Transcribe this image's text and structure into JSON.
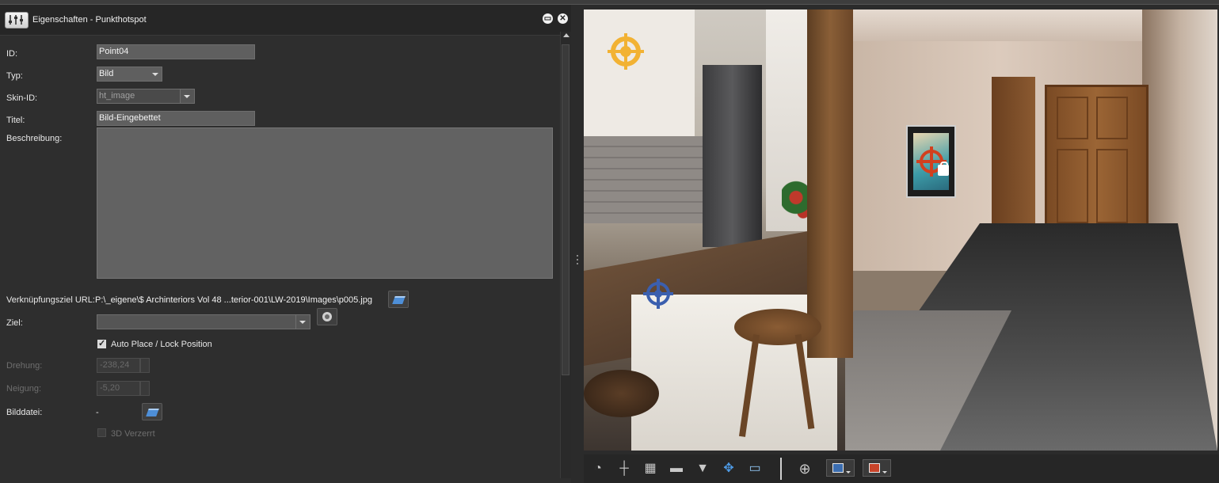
{
  "window": {
    "title": "Eigenschaften - Punkthotspot",
    "restore_icon": "restore-icon",
    "close_icon": "close-icon"
  },
  "form": {
    "id": {
      "label": "ID:",
      "value": "Point04"
    },
    "typ": {
      "label": "Typ:",
      "value": "Bild"
    },
    "skin_id": {
      "label": "Skin-ID:",
      "value": "ht_image"
    },
    "titel": {
      "label": "Titel:",
      "value": "Bild-Eingebettet"
    },
    "beschreibung": {
      "label": "Beschreibung:",
      "value": ""
    },
    "url": {
      "label": "Verknüpfungsziel URL:",
      "value": "P:\\_eigene\\$ Archinteriors Vol 48 ...terior-001\\LW-2019\\Images\\p005.jpg"
    },
    "ziel": {
      "label": "Ziel:",
      "value": ""
    },
    "auto_place": {
      "label": "Auto Place / Lock Position",
      "checked": true
    },
    "drehung": {
      "label": "Drehung:",
      "value": "-238,24"
    },
    "neigung": {
      "label": "Neigung:",
      "value": "-5,20"
    },
    "bilddatei": {
      "label": "Bilddatei:",
      "value": "-"
    },
    "verzerrt": {
      "label": "3D Verzerrt",
      "checked": false
    }
  },
  "viewer": {
    "hotspot_colors": {
      "yellow": "#f2b233",
      "red": "#d2401e",
      "blue": "#3b5fae"
    }
  },
  "toolbar": {
    "icons": [
      "compass-icon",
      "crosshair-line-icon",
      "grid-icon",
      "projector-icon",
      "tornado-icon",
      "move-arrows-icon",
      "panorama-icon",
      "target-icon"
    ],
    "color1": "#3b6db0",
    "color2": "#c8442a"
  }
}
